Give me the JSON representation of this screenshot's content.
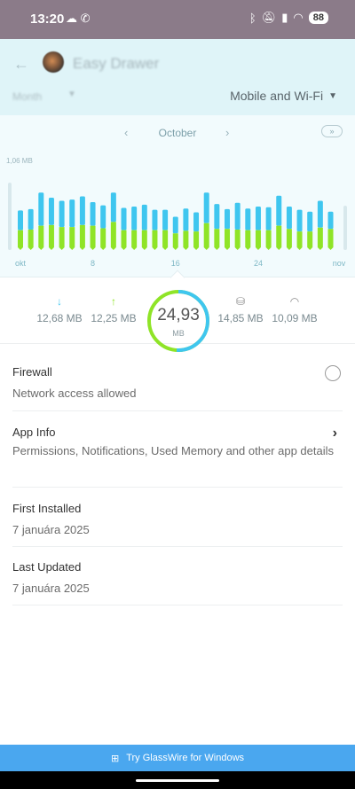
{
  "status_bar": {
    "time": "13:20",
    "battery": "88",
    "left_icons": [
      "cloud-icon",
      "viber-icon"
    ],
    "right_icons": [
      "bluetooth-icon",
      "mute-icon",
      "cellular-icon",
      "wifi-icon"
    ]
  },
  "header": {
    "title": "Easy Drawer",
    "period": "Month",
    "network": "Mobile and Wi-Fi"
  },
  "chart": {
    "month": "October"
  },
  "chart_data": {
    "type": "bar",
    "stacked": true,
    "ylabel_max": "1,06 MB",
    "x_ticks": [
      "okt",
      "8",
      "16",
      "24",
      "nov"
    ],
    "colors": {
      "upload": "#8fe427",
      "download": "#3fc6ef"
    },
    "categories": [
      "1",
      "2",
      "3",
      "4",
      "5",
      "6",
      "7",
      "8",
      "9",
      "10",
      "11",
      "12",
      "13",
      "14",
      "15",
      "16",
      "17",
      "18",
      "19",
      "20",
      "21",
      "22",
      "23",
      "24",
      "25",
      "26",
      "27",
      "28",
      "29",
      "30",
      "31"
    ],
    "series": [
      {
        "values": [
          0.31,
          0.32,
          0.38,
          0.39,
          0.36,
          0.36,
          0.39,
          0.38,
          0.34,
          0.44,
          0.31,
          0.31,
          0.31,
          0.31,
          0.31,
          0.26,
          0.3,
          0.29,
          0.42,
          0.33,
          0.33,
          0.32,
          0.31,
          0.31,
          0.31,
          0.38,
          0.33,
          0.29,
          0.29,
          0.35,
          0.33
        ]
      },
      {
        "values": [
          0.31,
          0.32,
          0.52,
          0.43,
          0.41,
          0.43,
          0.45,
          0.37,
          0.36,
          0.46,
          0.35,
          0.37,
          0.4,
          0.32,
          0.32,
          0.26,
          0.35,
          0.3,
          0.48,
          0.39,
          0.31,
          0.42,
          0.34,
          0.37,
          0.36,
          0.47,
          0.35,
          0.34,
          0.31,
          0.42,
          0.27
        ]
      }
    ]
  },
  "stats": {
    "download": "12,68 MB",
    "upload": "12,25 MB",
    "total": "24,93",
    "total_unit": "MB",
    "mobile": "14,85 MB",
    "wifi": "10,09 MB",
    "download_ratio": 0.509
  },
  "firewall": {
    "title": "Firewall",
    "subtitle": "Network access allowed"
  },
  "app_info": {
    "title": "App Info",
    "subtitle": "Permissions, Notifications, Used Memory and other app details"
  },
  "first_installed": {
    "title": "First Installed",
    "value": "7 januára 2025"
  },
  "last_updated": {
    "title": "Last Updated",
    "value": "7 januára 2025"
  },
  "promo": {
    "label": "Try GlassWire for Windows"
  }
}
